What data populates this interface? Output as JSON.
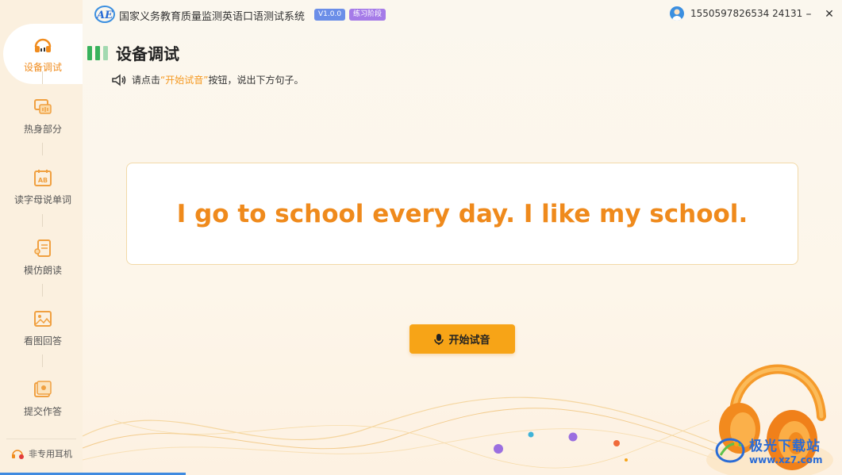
{
  "app": {
    "title": "国家义务教育质量监测英语口语测试系统",
    "version": "V1.0.0",
    "stage": "练习阶段",
    "user_id": "1550597826534 24131"
  },
  "sidebar": {
    "items": [
      {
        "label": "设备调试",
        "icon": "headphones-icon",
        "active": true
      },
      {
        "label": "热身部分",
        "icon": "chat-bubble-icon",
        "active": false
      },
      {
        "label": "读字母说单词",
        "icon": "ab-calendar-icon",
        "active": false
      },
      {
        "label": "模仿朗读",
        "icon": "reading-icon",
        "active": false
      },
      {
        "label": "看图回答",
        "icon": "picture-icon",
        "active": false
      },
      {
        "label": "提交作答",
        "icon": "submit-icon",
        "active": false
      }
    ],
    "earphone_label": "非专用耳机"
  },
  "main": {
    "title": "设备调试",
    "instruction_prefix": "请点击",
    "instruction_highlight": "“开始试音”",
    "instruction_suffix": "按钮，说出下方句子。",
    "sentence": "I go to school every day. I like my school.",
    "start_button_label": "开始试音"
  },
  "watermark": {
    "name": "极光下载站",
    "url": "www.xz7.com"
  },
  "colors": {
    "accent": "#f7a417",
    "sentence": "#ef8a1c",
    "active_nav": "#f08c1e",
    "heading_bar": "#38b25c"
  }
}
